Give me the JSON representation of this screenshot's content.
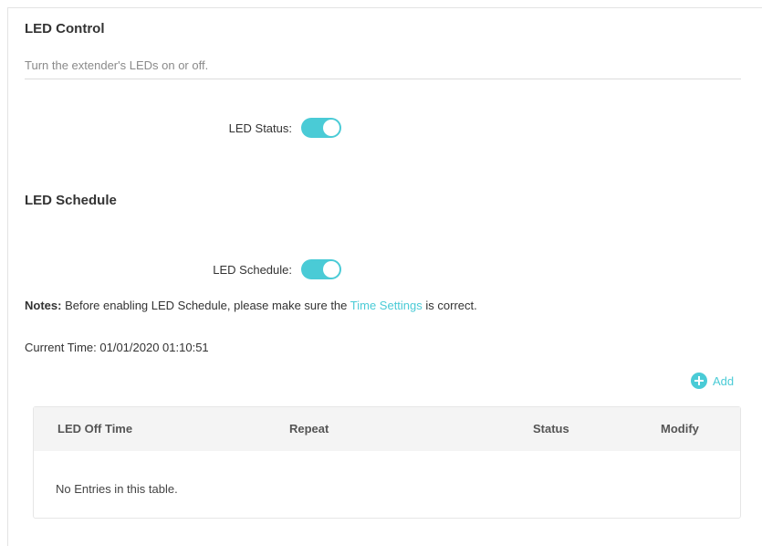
{
  "led_control": {
    "title": "LED Control",
    "description": "Turn the extender's LEDs on or off.",
    "status_label": "LED Status:",
    "status_on": true
  },
  "led_schedule": {
    "title": "LED Schedule",
    "schedule_label": "LED Schedule:",
    "schedule_on": true,
    "notes_prefix": "Notes:",
    "notes_text": "Before enabling LED Schedule, please make sure the",
    "notes_link": "Time Settings",
    "notes_suffix": "is correct.",
    "current_time_label": "Current Time:",
    "current_time_value": "01/01/2020 01:10:51",
    "add_label": "Add"
  },
  "table": {
    "columns": [
      "LED Off Time",
      "Repeat",
      "Status",
      "Modify"
    ],
    "empty_message": "No Entries in this table."
  },
  "colors": {
    "accent": "#4acbd6"
  }
}
